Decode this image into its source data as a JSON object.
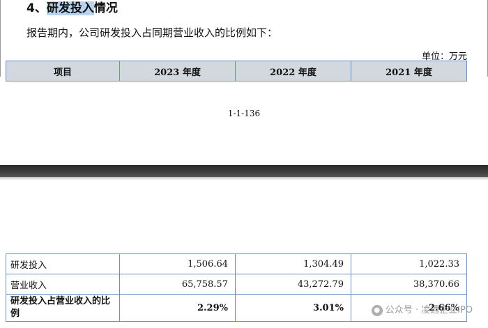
{
  "section": {
    "number": "4、",
    "title_highlighted": "研发投入",
    "title_rest": "情况"
  },
  "intro_text": "报告期内，公司研发投入占同期营业收入的比例如下：",
  "unit_label": "单位：万元",
  "table": {
    "headers": [
      "项目",
      "2023 年度",
      "2022 年度",
      "2021 年度"
    ],
    "rows": [
      {
        "label": "研发投入",
        "values": [
          "1,506.64",
          "1,304.49",
          "1,022.33"
        ]
      },
      {
        "label": "营业收入",
        "values": [
          "65,758.57",
          "43,272.79",
          "38,370.66"
        ]
      },
      {
        "label": "研发投入占营业收入的比例",
        "values": [
          "2.29%",
          "3.01%",
          "2.66%"
        ]
      }
    ]
  },
  "page_number": "1-1-136",
  "watermark": {
    "text": "公众号 · 凌通企业IPO"
  }
}
